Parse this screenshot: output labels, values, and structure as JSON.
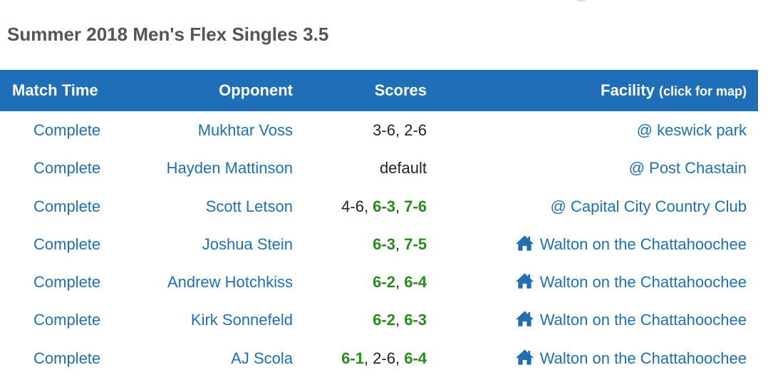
{
  "title": "Summer 2018 Men's Flex Singles 3.5",
  "headers": {
    "match_time": "Match Time",
    "opponent": "Opponent",
    "scores": "Scores",
    "facility": "Facility",
    "facility_hint": "(click for map)"
  },
  "colors": {
    "header_bg": "#1e6eb8",
    "link": "#1f6fb2",
    "win": "#2a8a1f"
  },
  "rows": [
    {
      "time": "Complete",
      "opponent": "Mukhtar Voss",
      "scores": [
        {
          "text": "3-6",
          "win": false
        },
        {
          "text": "2-6",
          "win": false
        }
      ],
      "facility": "@ keswick park",
      "home": false
    },
    {
      "time": "Complete",
      "opponent": "Hayden Mattinson",
      "scores": [
        {
          "text": "default",
          "win": false
        }
      ],
      "facility": "@ Post Chastain",
      "home": false
    },
    {
      "time": "Complete",
      "opponent": "Scott Letson",
      "scores": [
        {
          "text": "4-6",
          "win": false
        },
        {
          "text": "6-3",
          "win": true
        },
        {
          "text": "7-6",
          "win": true
        }
      ],
      "facility": "@ Capital City Country Club",
      "home": false
    },
    {
      "time": "Complete",
      "opponent": "Joshua Stein",
      "scores": [
        {
          "text": "6-3",
          "win": true
        },
        {
          "text": "7-5",
          "win": true
        }
      ],
      "facility": "Walton on the Chattahoochee",
      "home": true
    },
    {
      "time": "Complete",
      "opponent": "Andrew Hotchkiss",
      "scores": [
        {
          "text": "6-2",
          "win": true
        },
        {
          "text": "6-4",
          "win": true
        }
      ],
      "facility": "Walton on the Chattahoochee",
      "home": true
    },
    {
      "time": "Complete",
      "opponent": "Kirk Sonnefeld",
      "scores": [
        {
          "text": "6-2",
          "win": true
        },
        {
          "text": "6-3",
          "win": true
        }
      ],
      "facility": "Walton on the Chattahoochee",
      "home": true
    },
    {
      "time": "Complete",
      "opponent": "AJ Scola",
      "scores": [
        {
          "text": "6-1",
          "win": true
        },
        {
          "text": "2-6",
          "win": false
        },
        {
          "text": "6-4",
          "win": true
        }
      ],
      "facility": "Walton on the Chattahoochee",
      "home": true
    }
  ]
}
